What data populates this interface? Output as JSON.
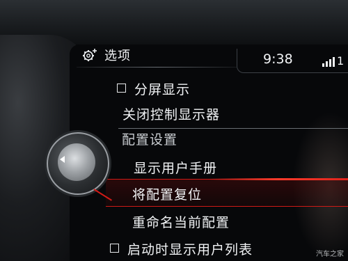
{
  "header": {
    "title": "选项",
    "icon": "gear-plus-icon"
  },
  "status": {
    "time": "9:38",
    "signal_label": "1"
  },
  "menu": {
    "items": [
      {
        "label": "分屏显示",
        "checkbox": true,
        "checked": false
      },
      {
        "label": "关闭控制显示器",
        "checkbox": false
      },
      {
        "label": "显示用户手册",
        "checkbox": false
      },
      {
        "label": "将配置复位",
        "checkbox": false,
        "selected": true
      },
      {
        "label": "重命名当前配置",
        "checkbox": false
      },
      {
        "label": "启动时显示用户列表",
        "checkbox": true,
        "checked": false
      }
    ],
    "section": "配置设置"
  },
  "colors": {
    "accent": "#d11a16",
    "text": "#f1f3f5"
  },
  "watermark": "汽车之家"
}
